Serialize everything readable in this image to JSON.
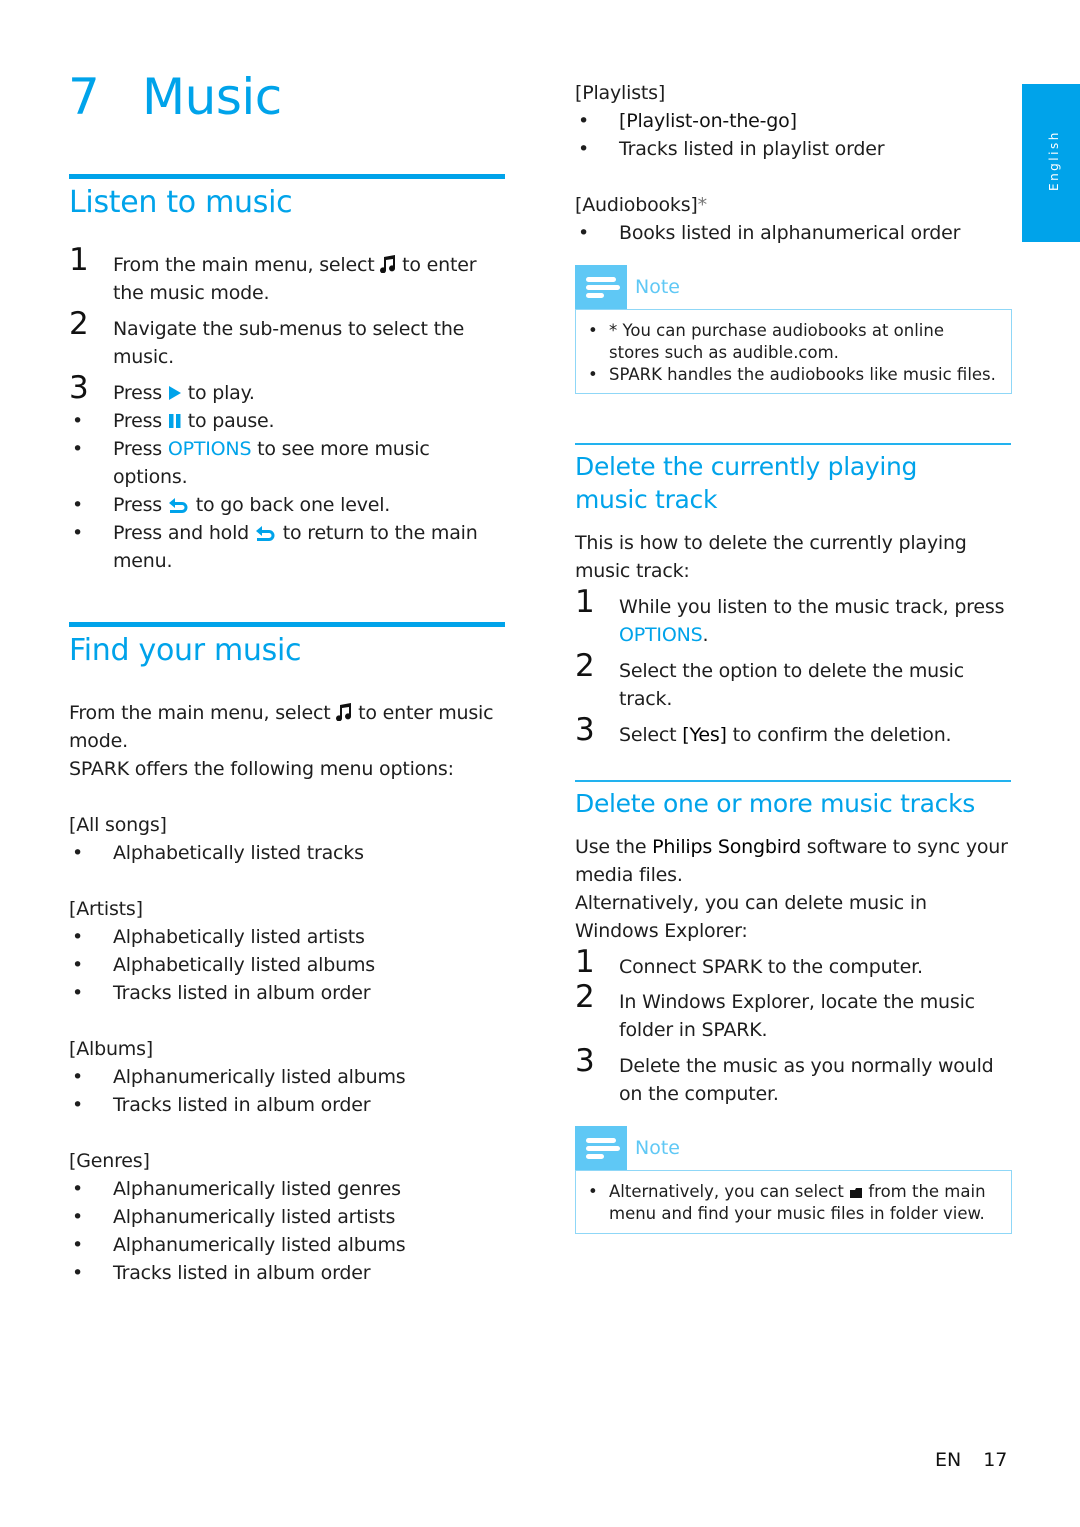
{
  "chapter": {
    "number": "7",
    "title": "Music"
  },
  "side_tab": {
    "label": "English"
  },
  "colors": {
    "accent": "#00a3ea",
    "note_accent": "#5fc8f5"
  },
  "listen": {
    "title": "Listen to music",
    "steps": [
      {
        "n": "1",
        "pre": "From the main menu, select ",
        "icon": "music-note-icon",
        "post": " to enter the music mode."
      },
      {
        "n": "2",
        "text": "Navigate the sub-menus to select the music."
      },
      {
        "n": "3",
        "pre": "Press ",
        "icon": "play-icon",
        "post": " to play."
      }
    ],
    "subs": [
      {
        "pre": "Press ",
        "icon": "pause-icon",
        "post": " to pause."
      },
      {
        "pre": "Press ",
        "highlight": "OPTIONS",
        "post": " to see more music options."
      },
      {
        "pre": "Press ",
        "icon": "back-icon",
        "post": " to go back one level."
      },
      {
        "pre": "Press and hold ",
        "icon": "back-icon",
        "post": " to return to the main menu."
      }
    ]
  },
  "find": {
    "title": "Find your music",
    "intro_pre": "From the main menu, select ",
    "intro_icon": "music-note-icon",
    "intro_post": " to enter music mode.",
    "intro2": "SPARK offers the following menu options:",
    "groups": [
      {
        "head": "[All songs]",
        "items": [
          "Alphabetically listed tracks"
        ]
      },
      {
        "head": "[Artists]",
        "items": [
          "Alphabetically listed artists",
          "Alphabetically listed albums",
          "Tracks listed in album order"
        ]
      },
      {
        "head": "[Albums]",
        "items": [
          "Alphanumerically listed albums",
          "Tracks listed in album order"
        ]
      },
      {
        "head": "[Genres]",
        "items": [
          "Alphanumerically listed genres",
          "Alphanumerically listed artists",
          "Alphanumerically listed albums",
          "Tracks listed in album order"
        ]
      },
      {
        "head": "[Playlists]",
        "items": [
          "[Playlist-on-the-go]",
          "Tracks listed in playlist order"
        ]
      },
      {
        "head": "[Audiobooks]",
        "head_suffix": "*",
        "items": [
          "Books listed in alphanumerical order"
        ]
      }
    ]
  },
  "note1": {
    "title": "Note",
    "items": [
      "* You can purchase audiobooks at online stores such as audible.com.",
      "SPARK handles the audiobooks like music files."
    ]
  },
  "delete_current": {
    "title": "Delete the currently playing music track",
    "intro": "This is how to delete the currently playing music track:",
    "steps": [
      {
        "n": "1",
        "pre": "While you listen to the music track, press ",
        "highlight": "OPTIONS",
        "post": "."
      },
      {
        "n": "2",
        "text": "Select the option to delete the music track."
      },
      {
        "n": "3",
        "pre": "Select ",
        "strong": "[Yes]",
        "post": " to confirm the deletion."
      }
    ]
  },
  "delete_more": {
    "title": "Delete one or more music tracks",
    "intro_pre": "Use the ",
    "intro_strong": "Philips Songbird",
    "intro_post": " software to sync your media files.",
    "intro2": "Alternatively, you can delete music in Windows Explorer:",
    "steps": [
      {
        "n": "1",
        "text": "Connect SPARK to the computer."
      },
      {
        "n": "2",
        "text": "In Windows Explorer, locate the music folder in SPARK."
      },
      {
        "n": "3",
        "text": "Delete the music as you normally would on the computer."
      }
    ]
  },
  "note2": {
    "title": "Note",
    "pre": "Alternatively, you can select ",
    "icon": "folder-icon",
    "post": " from the main menu and find your music files in folder view."
  },
  "footer": {
    "lang": "EN",
    "page": "17"
  }
}
